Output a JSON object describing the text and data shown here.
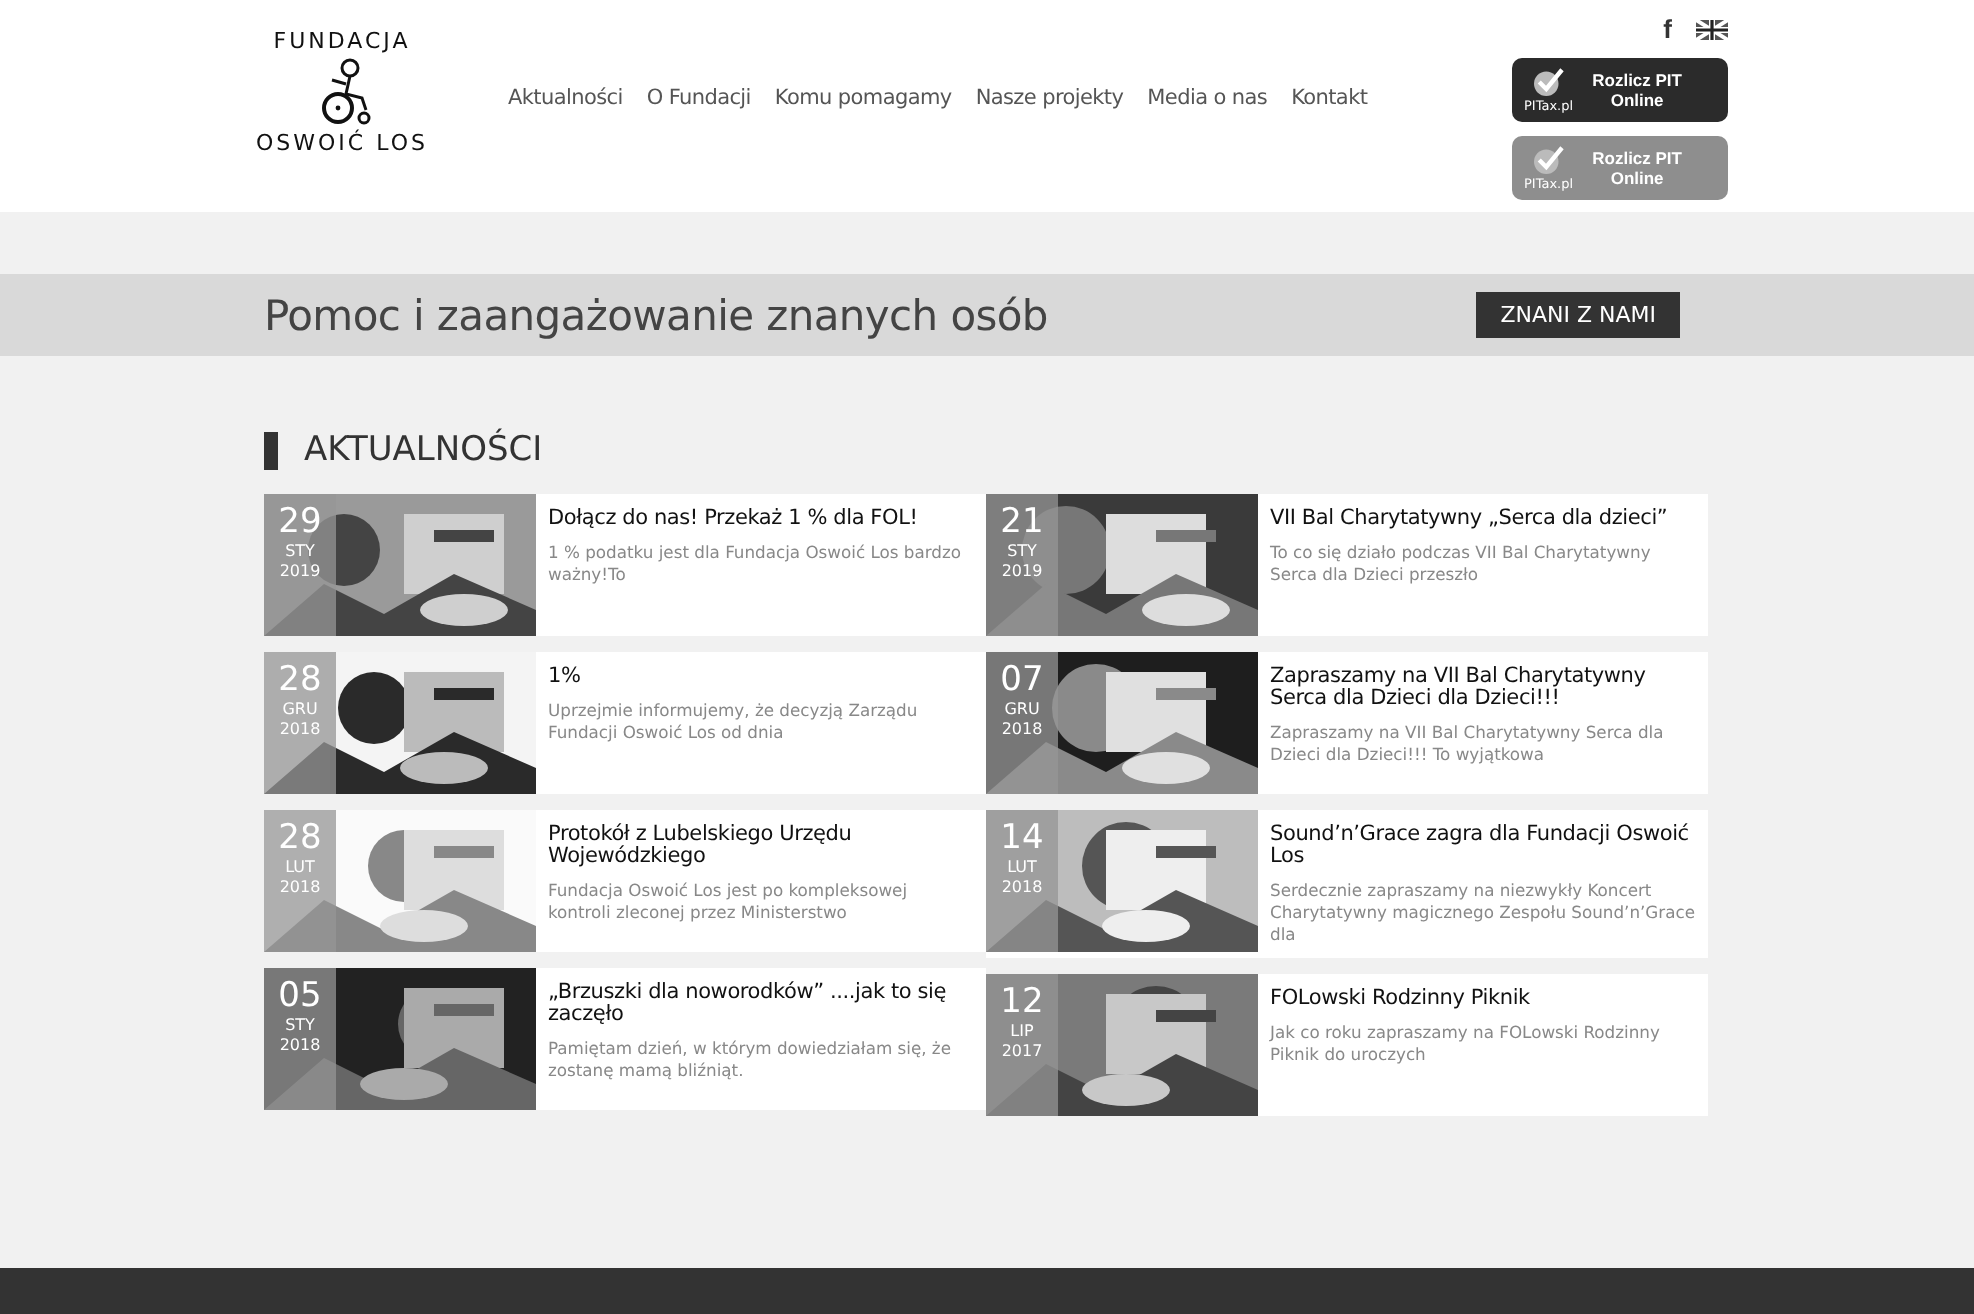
{
  "header": {
    "logo": {
      "top": "FUNDACJA",
      "bottom": "OSWOIĆ LOS"
    },
    "nav": [
      "Aktualności",
      "O Fundacji",
      "Komu pomagamy",
      "Nasze projekty",
      "Media o nas",
      "Kontakt"
    ],
    "facebook": "f",
    "pit_buttons": [
      {
        "brand": "PITax.pl",
        "label": "Rozlicz PIT Online",
        "kind": "dark"
      },
      {
        "brand": "PITax.pl",
        "label": "Rozlicz PIT Online",
        "kind": "light"
      }
    ]
  },
  "banner": {
    "title": "Pomoc i zaangażowanie znanych osób",
    "button": "ZNANI Z NAMI"
  },
  "news": {
    "heading": "AKTUALNOŚCI",
    "columns": [
      [
        {
          "day": "29",
          "month": "STY",
          "year": "2019",
          "title": "Dołącz do nas! Przekaż 1 % dla FOL!",
          "excerpt": "1 % podatku jest dla Fundacja Oswoić Los bardzo ważny!To"
        },
        {
          "day": "28",
          "month": "GRU",
          "year": "2018",
          "title": "1%",
          "excerpt": "Uprzejmie informujemy, że decyzją Zarządu Fundacji Oswoić Los od dnia"
        },
        {
          "day": "28",
          "month": "LUT",
          "year": "2018",
          "title": "Protokół z Lubelskiego Urzędu Wojewódzkiego",
          "excerpt": "Fundacja Oswoić Los jest po kompleksowej kontroli zleconej przez Ministerstwo"
        },
        {
          "day": "05",
          "month": "STY",
          "year": "2018",
          "title": "„Brzuszki dla noworodków” ....jak to się zaczęło",
          "excerpt": "Pamiętam dzień, w którym dowiedziałam się, że zostanę mamą bliźniąt."
        }
      ],
      [
        {
          "day": "21",
          "month": "STY",
          "year": "2019",
          "title": "VII Bal Charytatywny „Serca dla dzieci”",
          "excerpt": "To co się działo podczas VII Bal Charytatywny Serca dla Dzieci przeszło"
        },
        {
          "day": "07",
          "month": "GRU",
          "year": "2018",
          "title": "Zapraszamy na VII Bal Charytatywny Serca dla Dzieci dla Dzieci!!!",
          "excerpt": "Zapraszamy na VII Bal Charytatywny Serca dla Dzieci dla Dzieci!!!  To wyjątkowa"
        },
        {
          "day": "14",
          "month": "LUT",
          "year": "2018",
          "title": "Sound’n’Grace zagra dla Fundacji Oswoić Los",
          "excerpt": "Serdecznie zapraszamy na niezwykły Koncert Charytatywny magicznego Zespołu Sound’n’Grace dla"
        },
        {
          "day": "12",
          "month": "LIP",
          "year": "2017",
          "title": "FOLowski Rodzinny Piknik",
          "excerpt": "Jak co roku zapraszamy na FOLowski Rodzinny Piknik do uroczych"
        }
      ]
    ]
  }
}
